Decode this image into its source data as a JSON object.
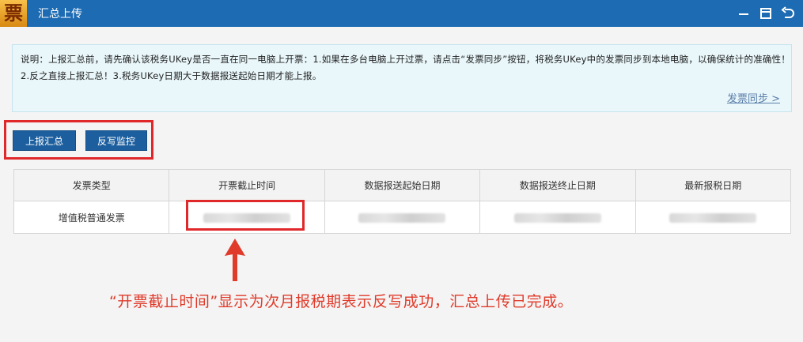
{
  "app": {
    "logo_glyph": "票",
    "title": "汇总上传"
  },
  "notice": {
    "text": "说明：上报汇总前，请先确认该税务UKey是否一直在同一电脑上开票：1.如果在多台电脑上开过票，请点击“发票同步”按钮，将税务UKey中的发票同步到本地电脑，以确保统计的准确性！2.反之直接上报汇总！3.税务UKey日期大于数据报送起始日期才能上报。",
    "sync_link": "发票同步 >"
  },
  "buttons": {
    "report_summary": "上报汇总",
    "writeback_monitor": "反写监控"
  },
  "table": {
    "columns": [
      "发票类型",
      "开票截止时间",
      "数据报送起始日期",
      "数据报送终止日期",
      "最新报税日期"
    ],
    "rows": [
      {
        "invoice_type": "增值税普通发票"
      }
    ]
  },
  "caption": "“开票截止时间”显示为次月报税期表示反写成功，汇总上传已完成。",
  "colors": {
    "titlebar": "#1d6bb3",
    "button": "#1d5f9e",
    "highlight": "#e0272a",
    "caption": "#e03a2a",
    "notice_bg": "#e9f7fb"
  },
  "icons": [
    "minimize-icon",
    "restore-icon",
    "back-icon",
    "up-arrow-icon"
  ]
}
